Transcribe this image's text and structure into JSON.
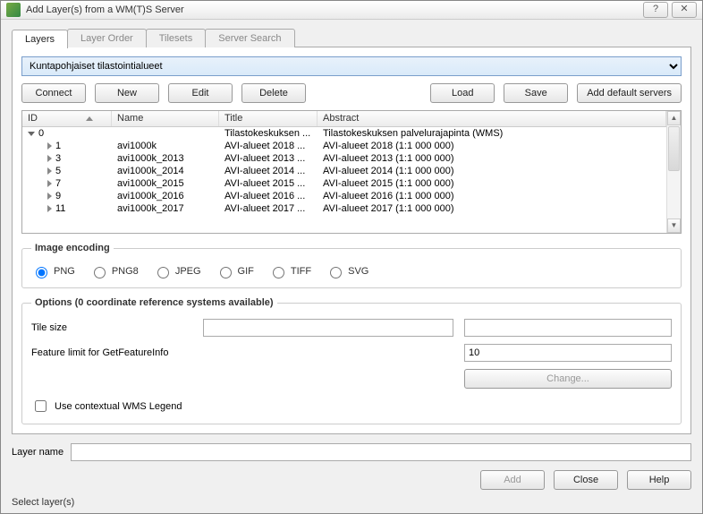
{
  "window": {
    "title": "Add Layer(s) from a WM(T)S Server"
  },
  "tabs": {
    "layers": "Layers",
    "layer_order": "Layer Order",
    "tilesets": "Tilesets",
    "server_search": "Server Search"
  },
  "server": {
    "selected": "Kuntapohjaiset tilastointialueet"
  },
  "buttons": {
    "connect": "Connect",
    "new": "New",
    "edit": "Edit",
    "delete": "Delete",
    "load": "Load",
    "save": "Save",
    "add_default": "Add default servers",
    "change": "Change...",
    "add": "Add",
    "close": "Close",
    "help": "Help"
  },
  "columns": {
    "id": "ID",
    "name": "Name",
    "title": "Title",
    "abstract": "Abstract"
  },
  "rows": {
    "root": {
      "id": "0",
      "name": "",
      "title": "Tilastokeskuksen ...",
      "abstract": "Tilastokeskuksen palvelurajapinta (WMS)"
    },
    "r1": {
      "id": "1",
      "name": "avi1000k",
      "title": "AVI-alueet 2018 ...",
      "abstract": "AVI-alueet 2018 (1:1 000 000)"
    },
    "r2": {
      "id": "3",
      "name": "avi1000k_2013",
      "title": "AVI-alueet 2013 ...",
      "abstract": "AVI-alueet 2013 (1:1 000 000)"
    },
    "r3": {
      "id": "5",
      "name": "avi1000k_2014",
      "title": "AVI-alueet 2014 ...",
      "abstract": "AVI-alueet 2014 (1:1 000 000)"
    },
    "r4": {
      "id": "7",
      "name": "avi1000k_2015",
      "title": "AVI-alueet 2015 ...",
      "abstract": "AVI-alueet 2015 (1:1 000 000)"
    },
    "r5": {
      "id": "9",
      "name": "avi1000k_2016",
      "title": "AVI-alueet 2016 ...",
      "abstract": "AVI-alueet 2016 (1:1 000 000)"
    },
    "r6": {
      "id": "11",
      "name": "avi1000k_2017",
      "title": "AVI-alueet 2017 ...",
      "abstract": "AVI-alueet 2017 (1:1 000 000)"
    }
  },
  "encoding": {
    "legend": "Image encoding",
    "png": "PNG",
    "png8": "PNG8",
    "jpeg": "JPEG",
    "gif": "GIF",
    "tiff": "TIFF",
    "svg": "SVG"
  },
  "options": {
    "legend": "Options (0 coordinate reference systems available)",
    "tile_size": "Tile size",
    "feature_limit": "Feature limit for GetFeatureInfo",
    "feature_limit_value": "10",
    "use_contextual": "Use contextual WMS Legend"
  },
  "layer_name": {
    "label": "Layer name",
    "value": ""
  },
  "status": "Select layer(s)"
}
